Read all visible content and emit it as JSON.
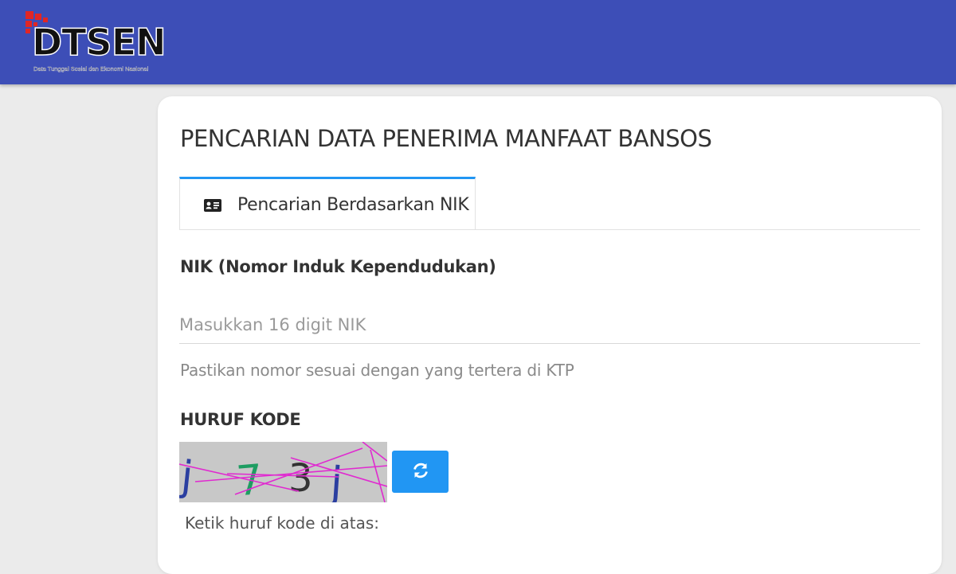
{
  "header": {
    "logo_text": "DTSEN",
    "logo_subtitle": "Data Tunggal Sosial dan Ekonomi Nasional",
    "logo_icon": "red-squares-logo-icon",
    "background": "#3d4eb7"
  },
  "page": {
    "title": "PENCARIAN DATA PENERIMA MANFAAT BANSOS"
  },
  "tabs": [
    {
      "label": "Pencarian Berdasarkan NIK",
      "icon": "id-card-icon",
      "active": true,
      "accent": "#2196f3"
    }
  ],
  "nik": {
    "label": "NIK (Nomor Induk Kependudukan)",
    "placeholder": "Masukkan 16 digit NIK",
    "value": "",
    "help": "Pastikan nomor sesuai dengan yang tertera di KTP"
  },
  "captcha": {
    "label": "HURUF KODE",
    "characters": [
      "j",
      "7",
      "3",
      "j"
    ],
    "refresh_icon": "refresh-icon",
    "hint": "Ketik huruf kode di atas:"
  }
}
